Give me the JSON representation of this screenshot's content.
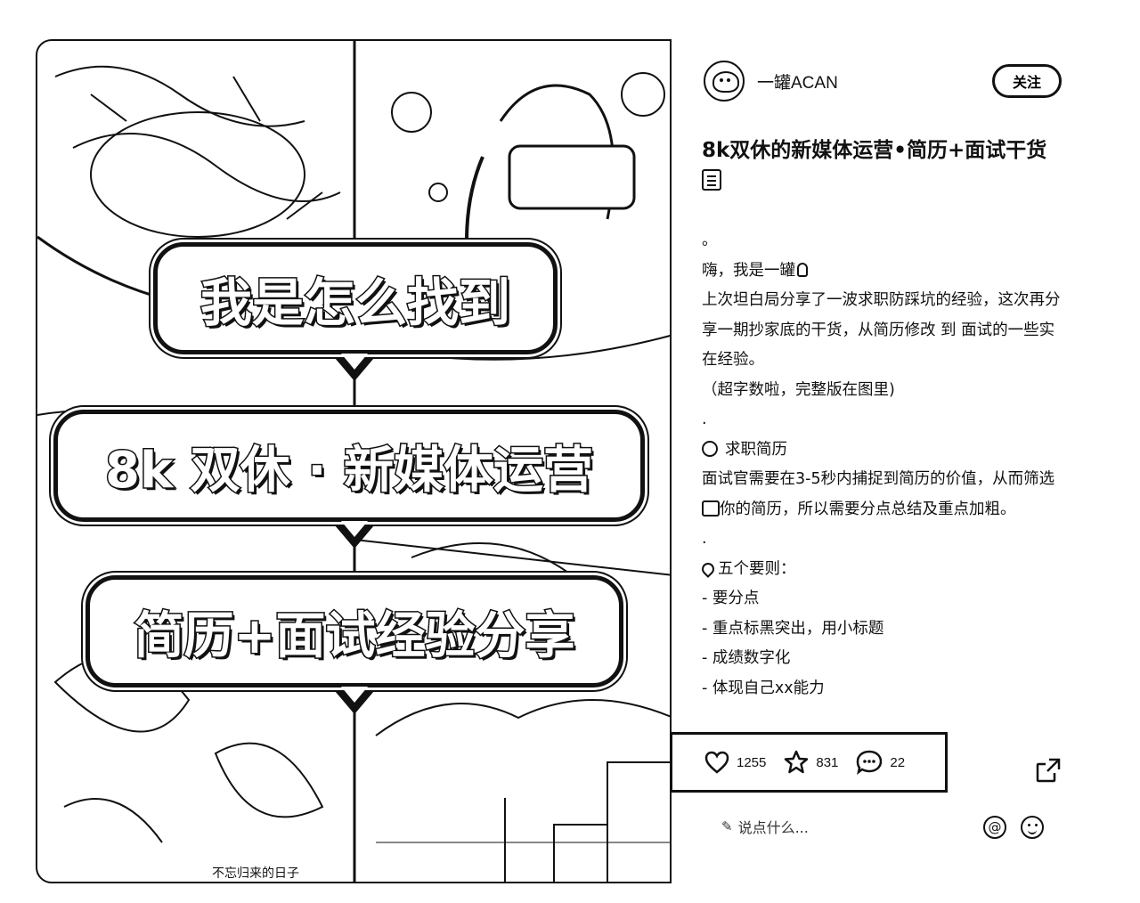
{
  "post_image": {
    "bubble_1": "我是怎么找到",
    "bubble_2": "8k 双休 · 新媒体运营",
    "bubble_3": "简历+面试经验分享",
    "caption": "不忘归来的日子"
  },
  "author": {
    "name": "一罐ACAN",
    "follow_label": "关注"
  },
  "post": {
    "title": "8k双休的新媒体运营•简历+面试干货",
    "lines": [
      "。",
      "嗨，我是一罐",
      "上次坦白局分享了一波求职防踩坑的经验，这次再分享一期抄家底的干货，从简历修改 到 面试的一些实在经验。",
      "（超字数啦，完整版在图里)",
      ".",
      "求职简历",
      "面试官需要在3-5秒内捕捉到简历的价值，从而筛选",
      "你的简历，所以需要分点总结及重点加粗。",
      ".",
      "五个要则：",
      "- 要分点",
      "- 重点标黑突出，用小标题",
      "- 成绩数字化",
      "- 体现自己xx能力"
    ]
  },
  "engagement": {
    "likes": "1255",
    "collects": "831",
    "comments": "22"
  },
  "comment_input": {
    "placeholder": "说点什么..."
  }
}
